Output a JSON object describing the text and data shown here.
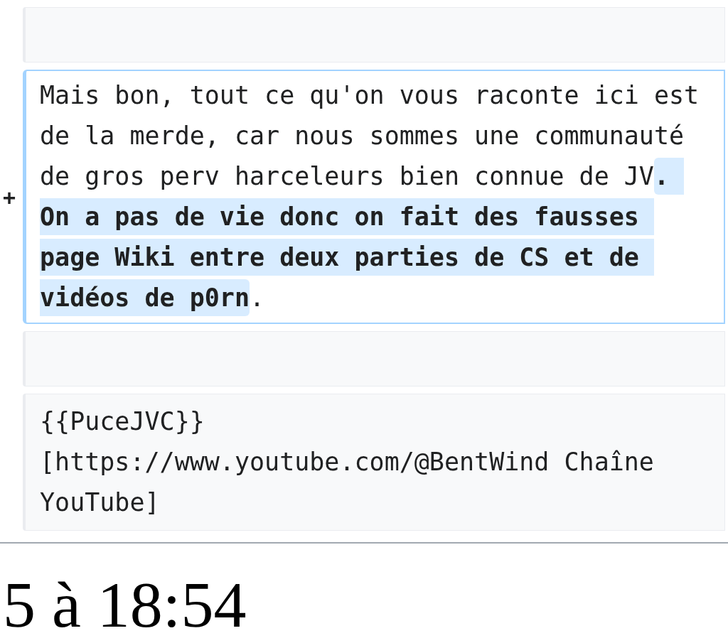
{
  "diff_blocks": [
    {
      "kind": "context"
    },
    {
      "kind": "added",
      "marker": "+",
      "segments": [
        {
          "text": "Mais bon, tout ce qu'on vous raconte ici est de la merde, car nous sommes une communauté de gros perv harceleurs bien connue de JV",
          "changed": false
        },
        {
          "text": ". On a pas de vie donc on fait des fausses page Wiki entre deux parties de CS et de vidéos de p0rn",
          "changed": true
        },
        {
          "text": ".",
          "changed": false
        }
      ]
    },
    {
      "kind": "context"
    },
    {
      "kind": "context",
      "lines": [
        "{{PuceJVC}}",
        "[https://www.youtube.com/@BentWind Chaîne YouTube]"
      ]
    }
  ],
  "timestamp": "5 à 18:54"
}
